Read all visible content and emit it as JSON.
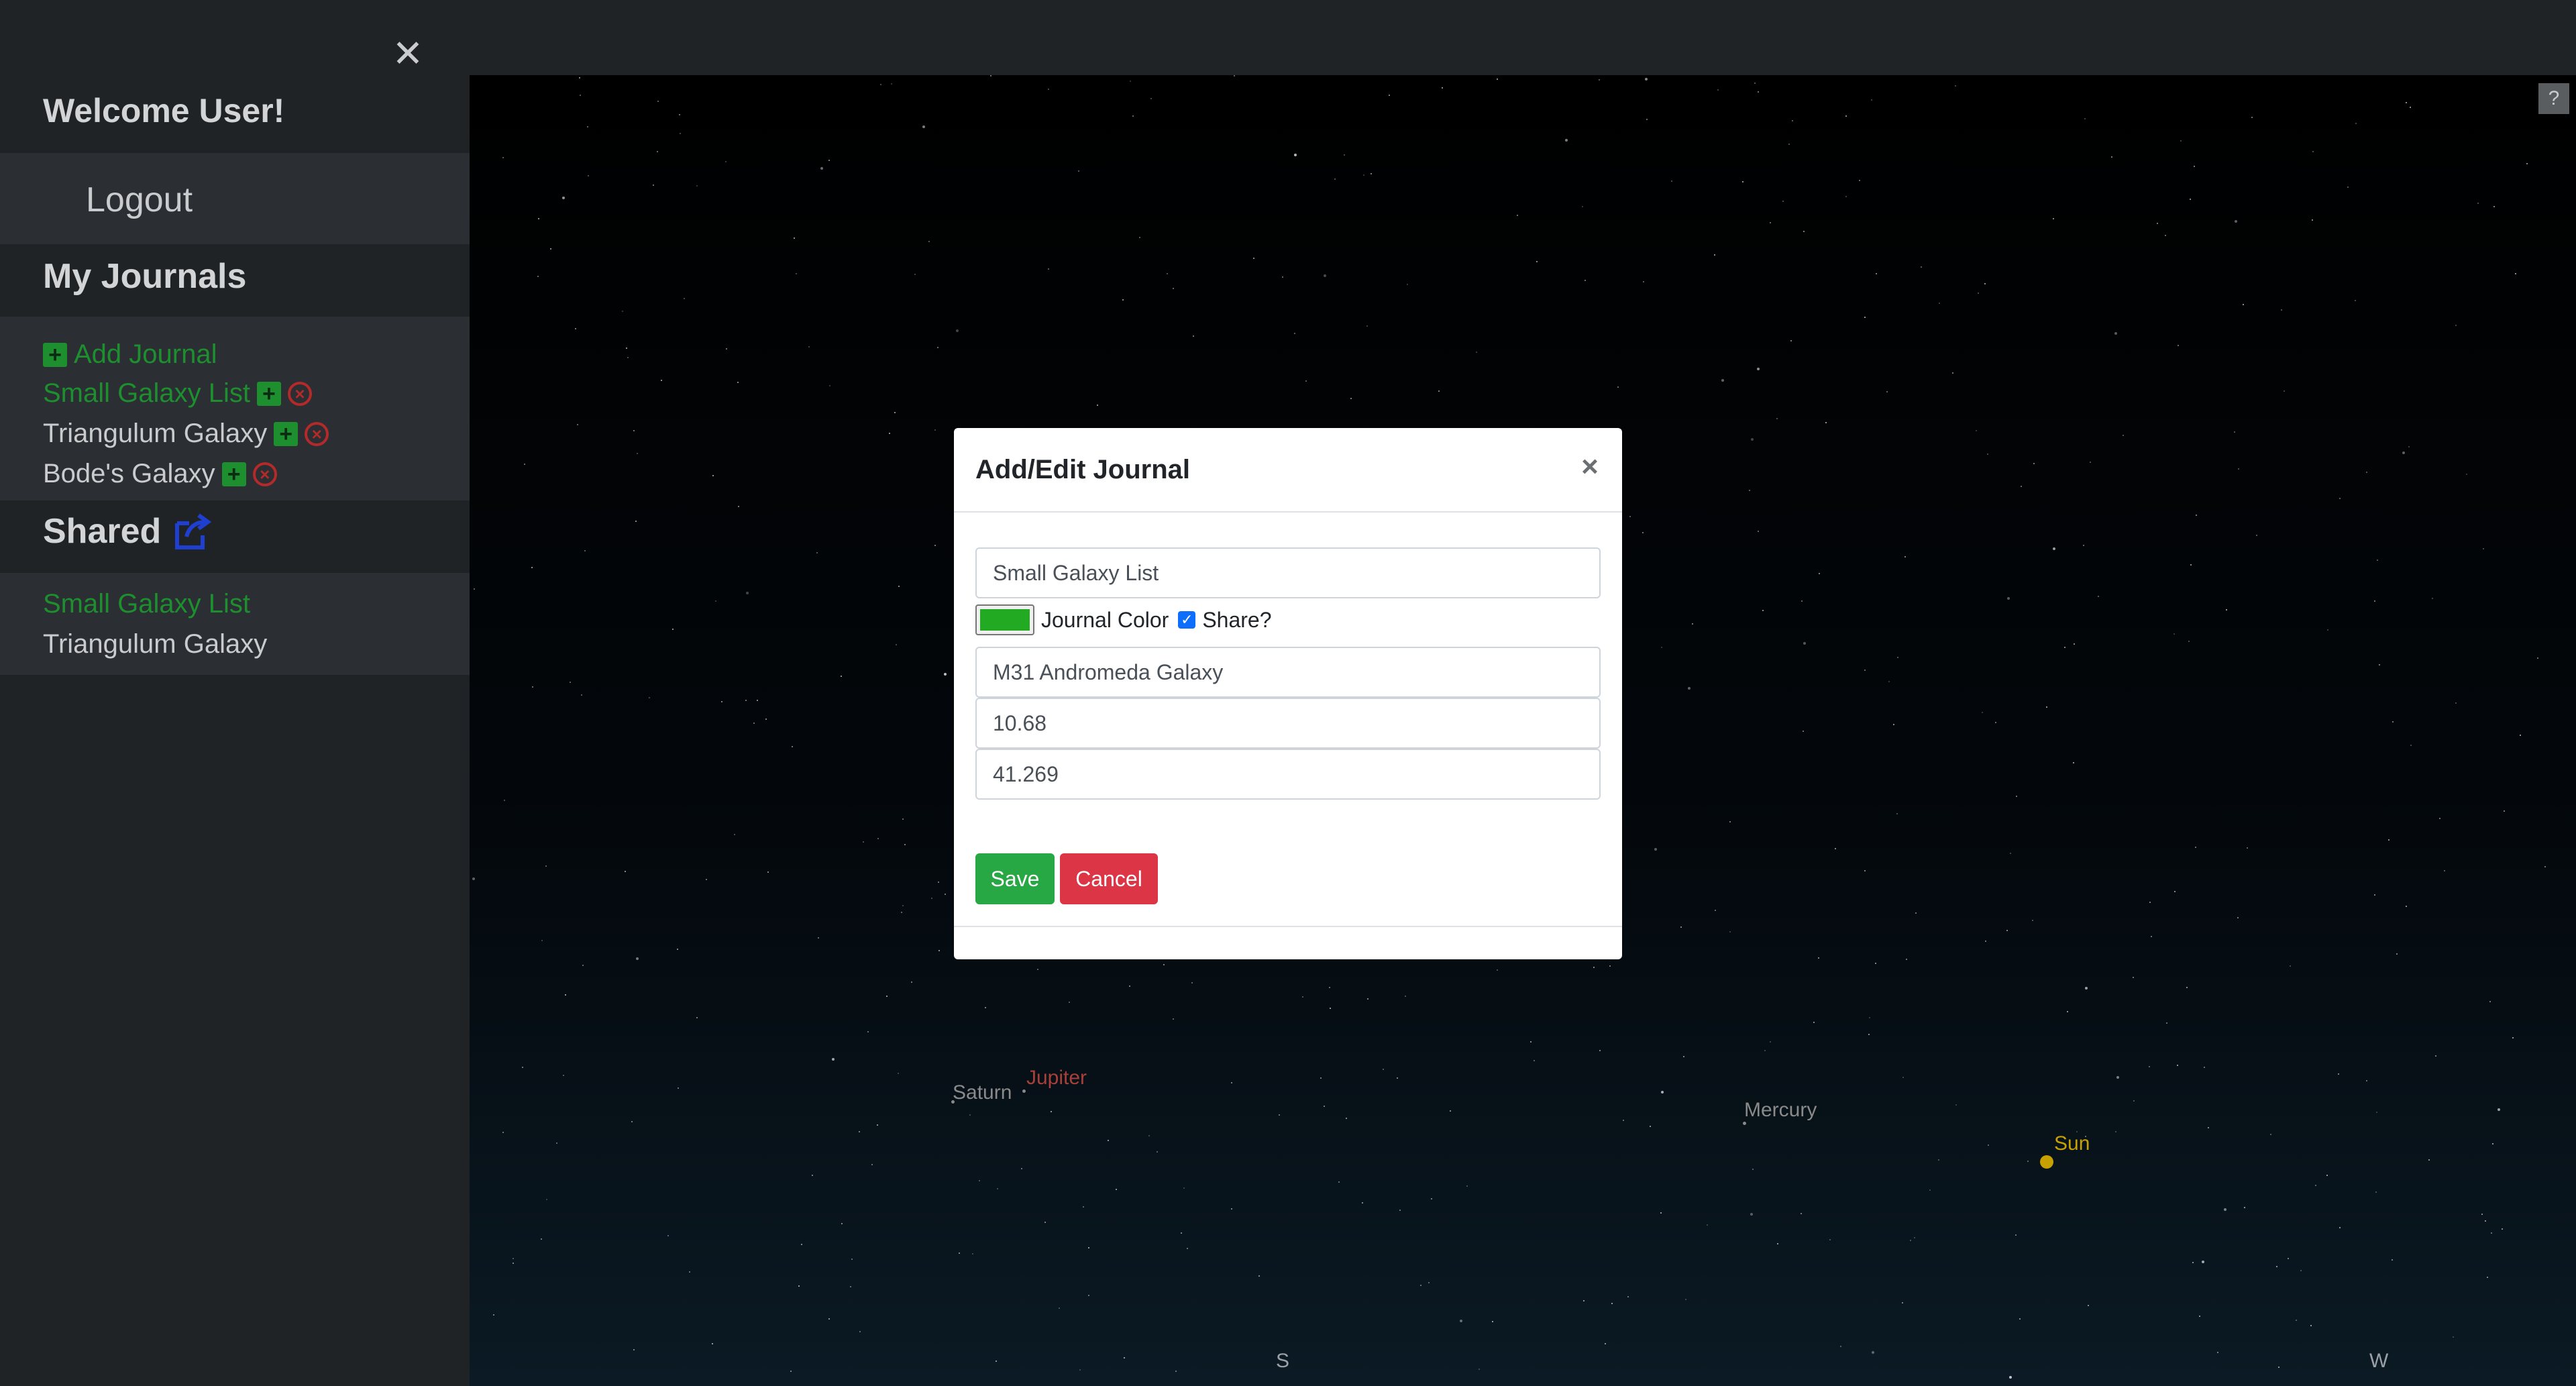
{
  "sidebar": {
    "close_glyph": "✕",
    "welcome": "Welcome User!",
    "logout": "Logout",
    "journals_heading": "My Journals",
    "journals": [
      {
        "label": "Add Journal",
        "color": "#1d8f2f"
      },
      {
        "label": "Small Galaxy List",
        "color": "#1d8f2f"
      },
      {
        "label": "Triangulum Galaxy",
        "color": "#c9cbcd"
      },
      {
        "label": "Bode's Galaxy",
        "color": "#c9cbcd"
      }
    ],
    "shared_heading": "Shared",
    "shared": [
      {
        "label": "Small Galaxy List",
        "color": "#1d8f2f"
      },
      {
        "label": "Triangulum Galaxy",
        "color": "#c9cbcd"
      }
    ]
  },
  "sky": {
    "help": "?",
    "planets": [
      {
        "label": "Saturn",
        "color": "#8a8a8a"
      },
      {
        "label": "Jupiter",
        "color": "#a8403a"
      },
      {
        "label": "Mercury",
        "color": "#8a8a8a"
      },
      {
        "label": "Sun",
        "color": "#c8a000"
      }
    ],
    "directions": [
      "S",
      "W"
    ]
  },
  "modal": {
    "title": "Add/Edit Journal",
    "close_glyph": "×",
    "journal_name": "Small Galaxy List",
    "color_label": "Journal Color",
    "color_value": "#22aa22",
    "share_label": "Share?",
    "share_checked": true,
    "object_name": "M31 Andromeda Galaxy",
    "ra": "10.68",
    "dec": "41.269",
    "save": "Save",
    "cancel": "Cancel",
    "save_color": "#28a745",
    "cancel_color": "#dc3545"
  }
}
